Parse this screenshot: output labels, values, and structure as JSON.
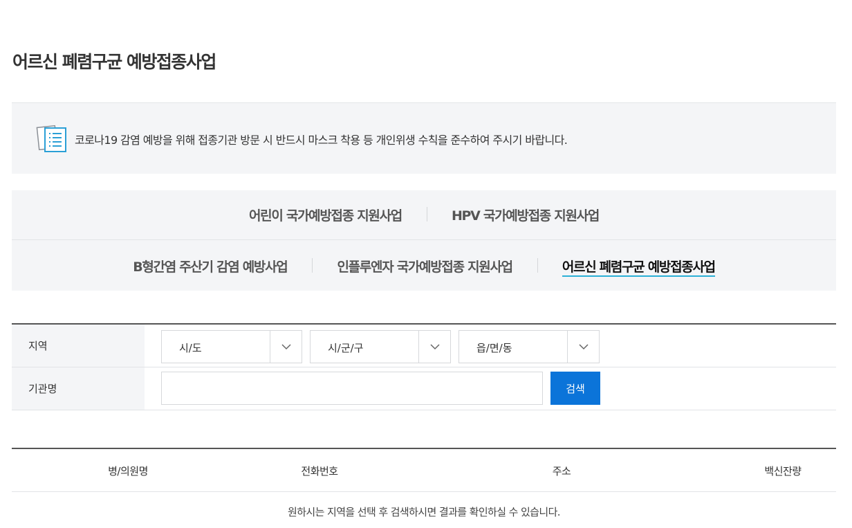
{
  "page": {
    "title": "어르신 폐렴구균 예방접종사업"
  },
  "notice": {
    "icon": "document-list-icon",
    "text": "코로나19 감염 예방을 위해 접종기관 방문 시 반드시 마스크 착용 등 개인위생 수칙을 준수하여 주시기 바랍니다."
  },
  "tabs": {
    "row1": [
      {
        "label": "어린이 국가예방접종 지원사업"
      },
      {
        "label": "HPV 국가예방접종 지원사업"
      }
    ],
    "row2": [
      {
        "label": "B형간염 주산기 감염 예방사업"
      },
      {
        "label": "인플루엔자 국가예방접종 지원사업"
      },
      {
        "label": "어르신 폐렴구균 예방접종사업",
        "active": true
      }
    ]
  },
  "search": {
    "region_label": "지역",
    "selects": [
      {
        "value": "시/도",
        "icon": "chevron-down-icon"
      },
      {
        "value": "시/군/구",
        "icon": "chevron-down-icon"
      },
      {
        "value": "읍/면/동",
        "icon": "chevron-down-icon"
      }
    ],
    "institution_label": "기관명",
    "institution_value": "",
    "button_label": "검색",
    "accent": "#0b74d9"
  },
  "results": {
    "columns": [
      "병/의원명",
      "전화번호",
      "주소",
      "백신잔량"
    ],
    "empty_message": "원하시는 지역을 선택 후 검색하시면 결과를 확인하실 수 있습니다."
  }
}
